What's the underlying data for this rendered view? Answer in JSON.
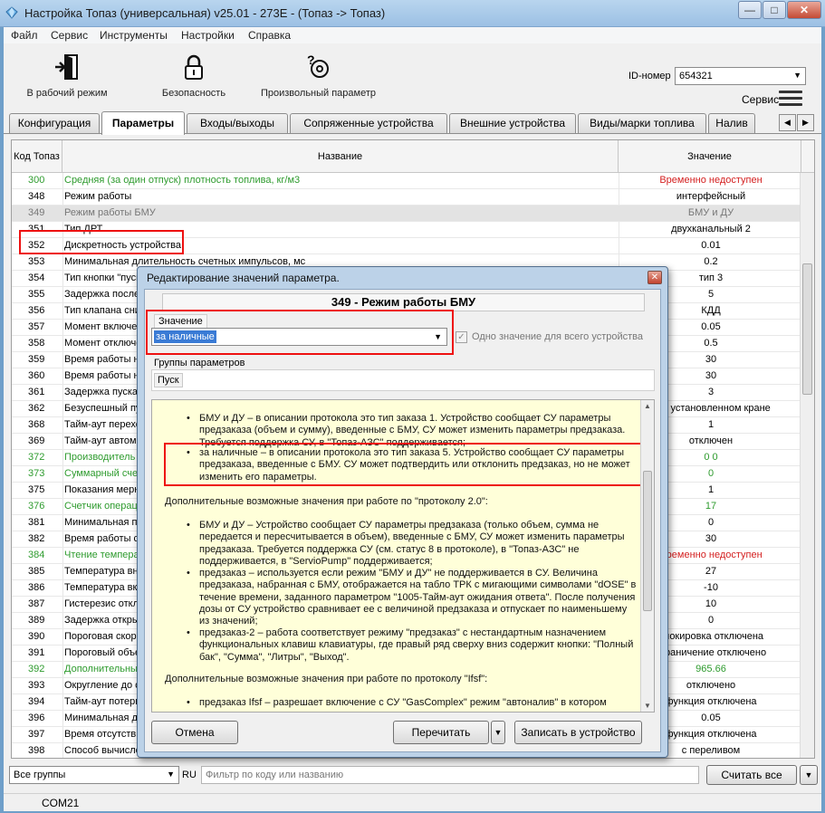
{
  "window": {
    "title": "Настройка Топаз (универсальная) v25.01 - 273E - (Топаз -> Топаз)",
    "min": "—",
    "max": "□",
    "close": "✕"
  },
  "menu": [
    "Файл",
    "Сервис",
    "Инструменты",
    "Настройки",
    "Справка"
  ],
  "toolbar": {
    "work_mode": "В рабочий режим",
    "security": "Безопасность",
    "arbitrary_param": "Произвольный параметр",
    "id_label": "ID-номер",
    "id_value": "654321",
    "service": "Сервис"
  },
  "tabs": [
    "Конфигурация",
    "Параметры",
    "Входы/выходы",
    "Сопряженные устройства",
    "Внешние устройства",
    "Виды/марки топлива",
    "Налив"
  ],
  "grid": {
    "col_code": "Код Топаз",
    "col_name": "Название",
    "col_value": "Значение",
    "rows": [
      {
        "code": "300",
        "name": "Средняя (за один отпуск) плотность топлива, кг/м3",
        "value": "Временно недоступен",
        "style": "green-red"
      },
      {
        "code": "348",
        "name": "Режим работы",
        "value": "интерфейсный",
        "style": ""
      },
      {
        "code": "349",
        "name": "Режим работы БМУ",
        "value": "БМУ и ДУ",
        "style": "sel"
      },
      {
        "code": "351",
        "name": "Тип ДРТ",
        "value": "двухканальный 2",
        "style": ""
      },
      {
        "code": "352",
        "name": "Дискретность устройства",
        "value": "0.01",
        "style": ""
      },
      {
        "code": "353",
        "name": "Минимальная длительность счетных импульсов, мс",
        "value": "0.2",
        "style": ""
      },
      {
        "code": "354",
        "name": "Тип кнопки \"пуск\"",
        "value": "тип 3",
        "style": ""
      },
      {
        "code": "355",
        "name": "Задержка после",
        "value": "5",
        "style": ""
      },
      {
        "code": "356",
        "name": "Тип клапана сни",
        "value": "КДД",
        "style": ""
      },
      {
        "code": "357",
        "name": "Момент включен",
        "value": "0.05",
        "style": ""
      },
      {
        "code": "358",
        "name": "Момент отключе",
        "value": "0.5",
        "style": ""
      },
      {
        "code": "359",
        "name": "Время работы на",
        "value": "30",
        "style": ""
      },
      {
        "code": "360",
        "name": "Время работы на",
        "value": "30",
        "style": ""
      },
      {
        "code": "361",
        "name": "Задержка пуска",
        "value": "3",
        "style": ""
      },
      {
        "code": "362",
        "name": "Безуспешный пу",
        "value": "при установленном кране",
        "style": ""
      },
      {
        "code": "368",
        "name": "Тайм-аут перехо",
        "value": "1",
        "style": ""
      },
      {
        "code": "369",
        "name": "Тайм-аут автома",
        "value": "отключен",
        "style": ""
      },
      {
        "code": "372",
        "name": "Производитель",
        "value": "0 0",
        "style": "green"
      },
      {
        "code": "373",
        "name": "Суммарный счет",
        "value": "0",
        "style": "green"
      },
      {
        "code": "375",
        "name": "Показания мерни",
        "value": "1",
        "style": ""
      },
      {
        "code": "376",
        "name": "Счетчик операц",
        "value": "17",
        "style": "green"
      },
      {
        "code": "381",
        "name": "Минимальная пр",
        "value": "0",
        "style": ""
      },
      {
        "code": "382",
        "name": "Время работы с",
        "value": "30",
        "style": ""
      },
      {
        "code": "384",
        "name": "Чтение темпера",
        "value": "Временно недоступен",
        "style": "green-red"
      },
      {
        "code": "385",
        "name": "Температура вну",
        "value": "27",
        "style": ""
      },
      {
        "code": "386",
        "name": "Температура вкл",
        "value": "-10",
        "style": ""
      },
      {
        "code": "387",
        "name": "Гистерезис откл",
        "value": "10",
        "style": ""
      },
      {
        "code": "389",
        "name": "Задержка откры",
        "value": "0",
        "style": ""
      },
      {
        "code": "390",
        "name": "Пороговая скоро",
        "value": "блокировка отключена",
        "style": ""
      },
      {
        "code": "391",
        "name": "Пороговый объе",
        "value": "ограничение отключено",
        "style": ""
      },
      {
        "code": "392",
        "name": "Дополнительны",
        "value": "965.66",
        "style": "green"
      },
      {
        "code": "393",
        "name": "Округление до с",
        "value": "отключено",
        "style": ""
      },
      {
        "code": "394",
        "name": "Тайм-аут потери",
        "value": "функция отключена",
        "style": ""
      },
      {
        "code": "396",
        "name": "Минимальная дл",
        "value": "0.05",
        "style": ""
      },
      {
        "code": "397",
        "name": "Время отсутстви",
        "value": "функция отключена",
        "style": ""
      },
      {
        "code": "398",
        "name": "Способ вычисле",
        "value": "с переливом",
        "style": ""
      }
    ]
  },
  "bottom": {
    "group_value": "Все группы",
    "lang": "RU",
    "filter_placeholder": "Фильтр по коду или названию",
    "read_all": "Считать все",
    "status_port": "COM21"
  },
  "dialog": {
    "title": "Редактирование значений параметра.",
    "header": "349 - Режим работы БМУ",
    "value_label": "Значение",
    "value": "за наличные",
    "same_value_label": "Одно значение для всего устройства",
    "groups_label": "Группы параметров",
    "group_tag": "Пуск",
    "help": {
      "b1": "БМУ и ДУ – в описании протокола это тип заказа 1. Устройство сообщает СУ параметры предзаказа (объем и сумму), введенные с БМУ, СУ может изменить параметры предзаказа. Требуется поддержка СУ, в \"Топаз-АЗС\" поддерживается;",
      "b2": "за наличные – в описании протокола это тип заказа 5. Устройство сообщает СУ параметры предзаказа, введенные с БМУ. СУ может подтвердить или отклонить предзаказ, но не может изменить его параметры.",
      "p1": "Дополнительные возможные значения при работе по \"протоколу 2.0\":",
      "b3": "БМУ и ДУ – Устройство сообщает СУ параметры предзаказа (только объем, сумма не передается и пересчитывается в объем), введенные с БМУ, СУ может изменить параметры предзаказа. Требуется поддержка СУ (см. статус 8 в протоколе), в \"Топаз-АЗС\" не поддерживается, в \"ServioPump\" поддерживается;",
      "b4": "предзаказ – используется если режим \"БМУ и ДУ\" не поддерживается в СУ. Величина предзаказа, набранная с БМУ, отображается на табло ТРК с мигающими символами \"dOSE\" в течение времени, заданного параметром \"1005-Тайм-аут ожидания ответа\". После получения дозы от СУ устройство сравнивает ее с величиной предзаказа и отпускает по наименьшему из значений;",
      "b5": "предзаказ-2 – работа соответствует режиму \"предзаказ\" с нестандартным назначением функциональных клавиш клавиатуры, где правый ряд сверху вниз содержит кнопки: \"Полный бак\", \"Сумма\", \"Литры\", \"Выход\".",
      "p2": "Дополнительные возможные значения при работе по протоколу \"Ifsf\":",
      "b6": "предзаказ Ifsf – разрешает включение с СУ \"GasComplex\" режим \"автоналив\" в котором"
    },
    "cancel": "Отмена",
    "reread": "Перечитать",
    "write": "Записать в устройство"
  },
  "colors": {
    "green": "#2e9b2e",
    "red_value": "#d42020",
    "highlight_red": "#e11111",
    "help_bg": "#ffffd9",
    "selection_blue": "#3a7bd5"
  }
}
